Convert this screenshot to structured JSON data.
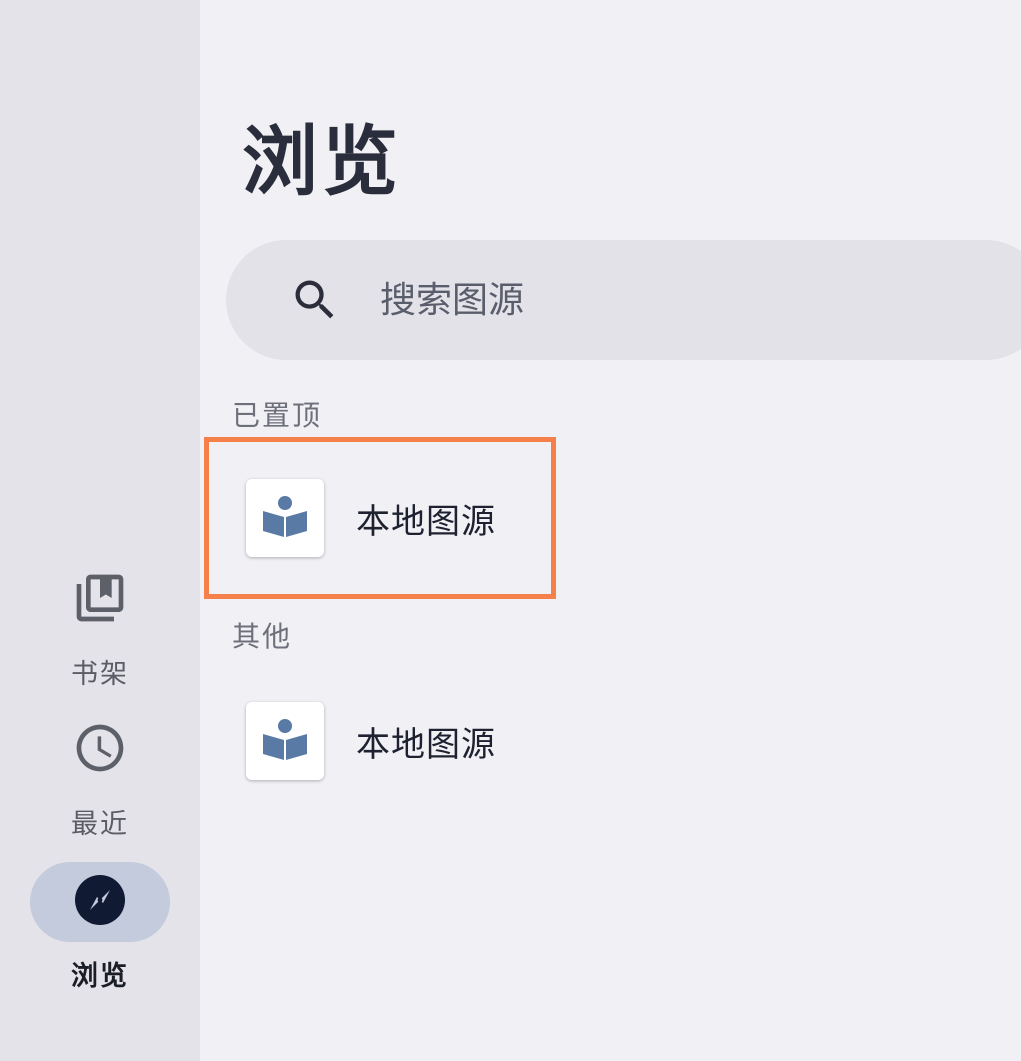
{
  "page": {
    "title": "浏览"
  },
  "search": {
    "placeholder": "搜索图源",
    "value": ""
  },
  "sections": [
    {
      "label": "已置顶",
      "items": [
        {
          "name": "本地图源",
          "icon": "book-reader-icon",
          "highlighted": true
        }
      ]
    },
    {
      "label": "其他",
      "items": [
        {
          "name": "本地图源",
          "icon": "book-reader-icon",
          "highlighted": false
        }
      ]
    }
  ],
  "nav": {
    "items": [
      {
        "id": "library",
        "label": "书架",
        "icon": "bookshelf-icon",
        "active": false
      },
      {
        "id": "recent",
        "label": "最近",
        "icon": "clock-icon",
        "active": false
      },
      {
        "id": "browse",
        "label": "浏览",
        "icon": "compass-icon",
        "active": true
      }
    ]
  },
  "colors": {
    "background": "#f1f0f5",
    "rail": "#e4e3e9",
    "active_pill": "#c4cbdc",
    "highlight": "#f6804a",
    "icon_blue": "#5a7aa6"
  }
}
